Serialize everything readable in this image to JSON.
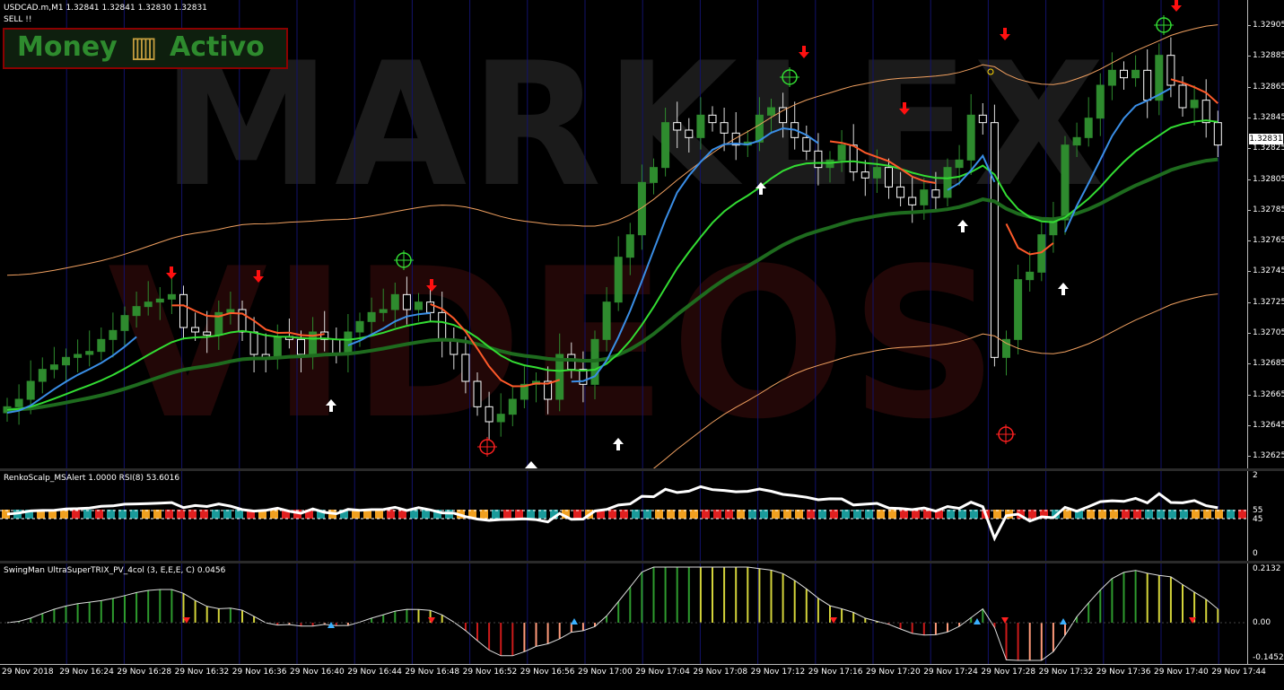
{
  "main": {
    "symbol_line": "USDCAD.m,M1  1.32841 1.32841 1.32830 1.32831",
    "signal_text": "SELL !!",
    "current_price": "1.32831",
    "price_labels": [
      "1.32905",
      "1.32885",
      "1.32865",
      "1.32845",
      "1.32825",
      "1.32805",
      "1.32785",
      "1.32765",
      "1.32745",
      "1.32725",
      "1.32705",
      "1.32685",
      "1.32665",
      "1.32645",
      "1.32625"
    ],
    "logo": {
      "left": "Money",
      "right": "Activo"
    },
    "watermark": {
      "line1": "MARKLEX",
      "line2": "VIDEOS"
    }
  },
  "rsi": {
    "title": "RenkoScalp_MSAlert 1.0000  RSI(8) 53.6016",
    "levels": [
      "2",
      "55",
      "45",
      "0"
    ]
  },
  "trix": {
    "title": "SwingMan UltraSuperTRIX_PV_4col (3, E,E,E, C) 0.0456",
    "levels": [
      "0.2132",
      "0.00",
      "-0.1452"
    ]
  },
  "time_labels": [
    "29 Nov 2018",
    "29 Nov 16:24",
    "29 Nov 16:28",
    "29 Nov 16:32",
    "29 Nov 16:36",
    "29 Nov 16:40",
    "29 Nov 16:44",
    "29 Nov 16:48",
    "29 Nov 16:52",
    "29 Nov 16:56",
    "29 Nov 17:00",
    "29 Nov 17:04",
    "29 Nov 17:08",
    "29 Nov 17:12",
    "29 Nov 17:16",
    "29 Nov 17:20",
    "29 Nov 17:24",
    "29 Nov 17:28",
    "29 Nov 17:32",
    "29 Nov 17:36",
    "29 Nov 17:40",
    "29 Nov 17:44"
  ],
  "colors": {
    "bull": "#2e8b2e",
    "bear": "#ffffff",
    "ma_thick": "#1e6b1e",
    "fast_green": "#33dd33",
    "blue": "#3a8ee6",
    "orange_red": "#ff5a2a",
    "envelope": "#f0a060",
    "down_arrow": "#ff1010",
    "up_arrow": "#ffffff",
    "sq_teal": "#1a9a9a",
    "sq_orange": "#f0a020",
    "sq_red": "#e02020"
  },
  "chart_data": {
    "type": "candlestick",
    "symbol": "USDCAD.m",
    "timeframe": "M1",
    "ylim": [
      1.32615,
      1.32915
    ],
    "close": [
      1.32655,
      1.3266,
      1.32672,
      1.3268,
      1.32683,
      1.32688,
      1.3269,
      1.32692,
      1.327,
      1.32706,
      1.32716,
      1.32722,
      1.32725,
      1.32727,
      1.3273,
      1.32708,
      1.32705,
      1.32703,
      1.32718,
      1.3272,
      1.32705,
      1.3269,
      1.32688,
      1.32702,
      1.327,
      1.3269,
      1.32705,
      1.327,
      1.3269,
      1.32705,
      1.32712,
      1.32718,
      1.3272,
      1.3273,
      1.3272,
      1.32725,
      1.32718,
      1.327,
      1.3269,
      1.32672,
      1.32655,
      1.32645,
      1.3265,
      1.3266,
      1.3267,
      1.32672,
      1.3266,
      1.3269,
      1.3268,
      1.3267,
      1.327,
      1.32725,
      1.32755,
      1.3277,
      1.32805,
      1.32815,
      1.32845,
      1.3284,
      1.32835,
      1.3285,
      1.32845,
      1.32838,
      1.3283,
      1.32832,
      1.3285,
      1.32855,
      1.32845,
      1.32835,
      1.32826,
      1.32815,
      1.3282,
      1.3283,
      1.32812,
      1.32808,
      1.32815,
      1.32802,
      1.32795,
      1.3279,
      1.328,
      1.32795,
      1.32815,
      1.3282,
      1.3285,
      1.32845,
      1.32688,
      1.327,
      1.3274,
      1.32745,
      1.3277,
      1.3278,
      1.3283,
      1.32835,
      1.32848,
      1.3287,
      1.3288,
      1.32875,
      1.3288,
      1.3286,
      1.3289,
      1.3287,
      1.32855,
      1.3286,
      1.32845,
      1.3283
    ]
  }
}
